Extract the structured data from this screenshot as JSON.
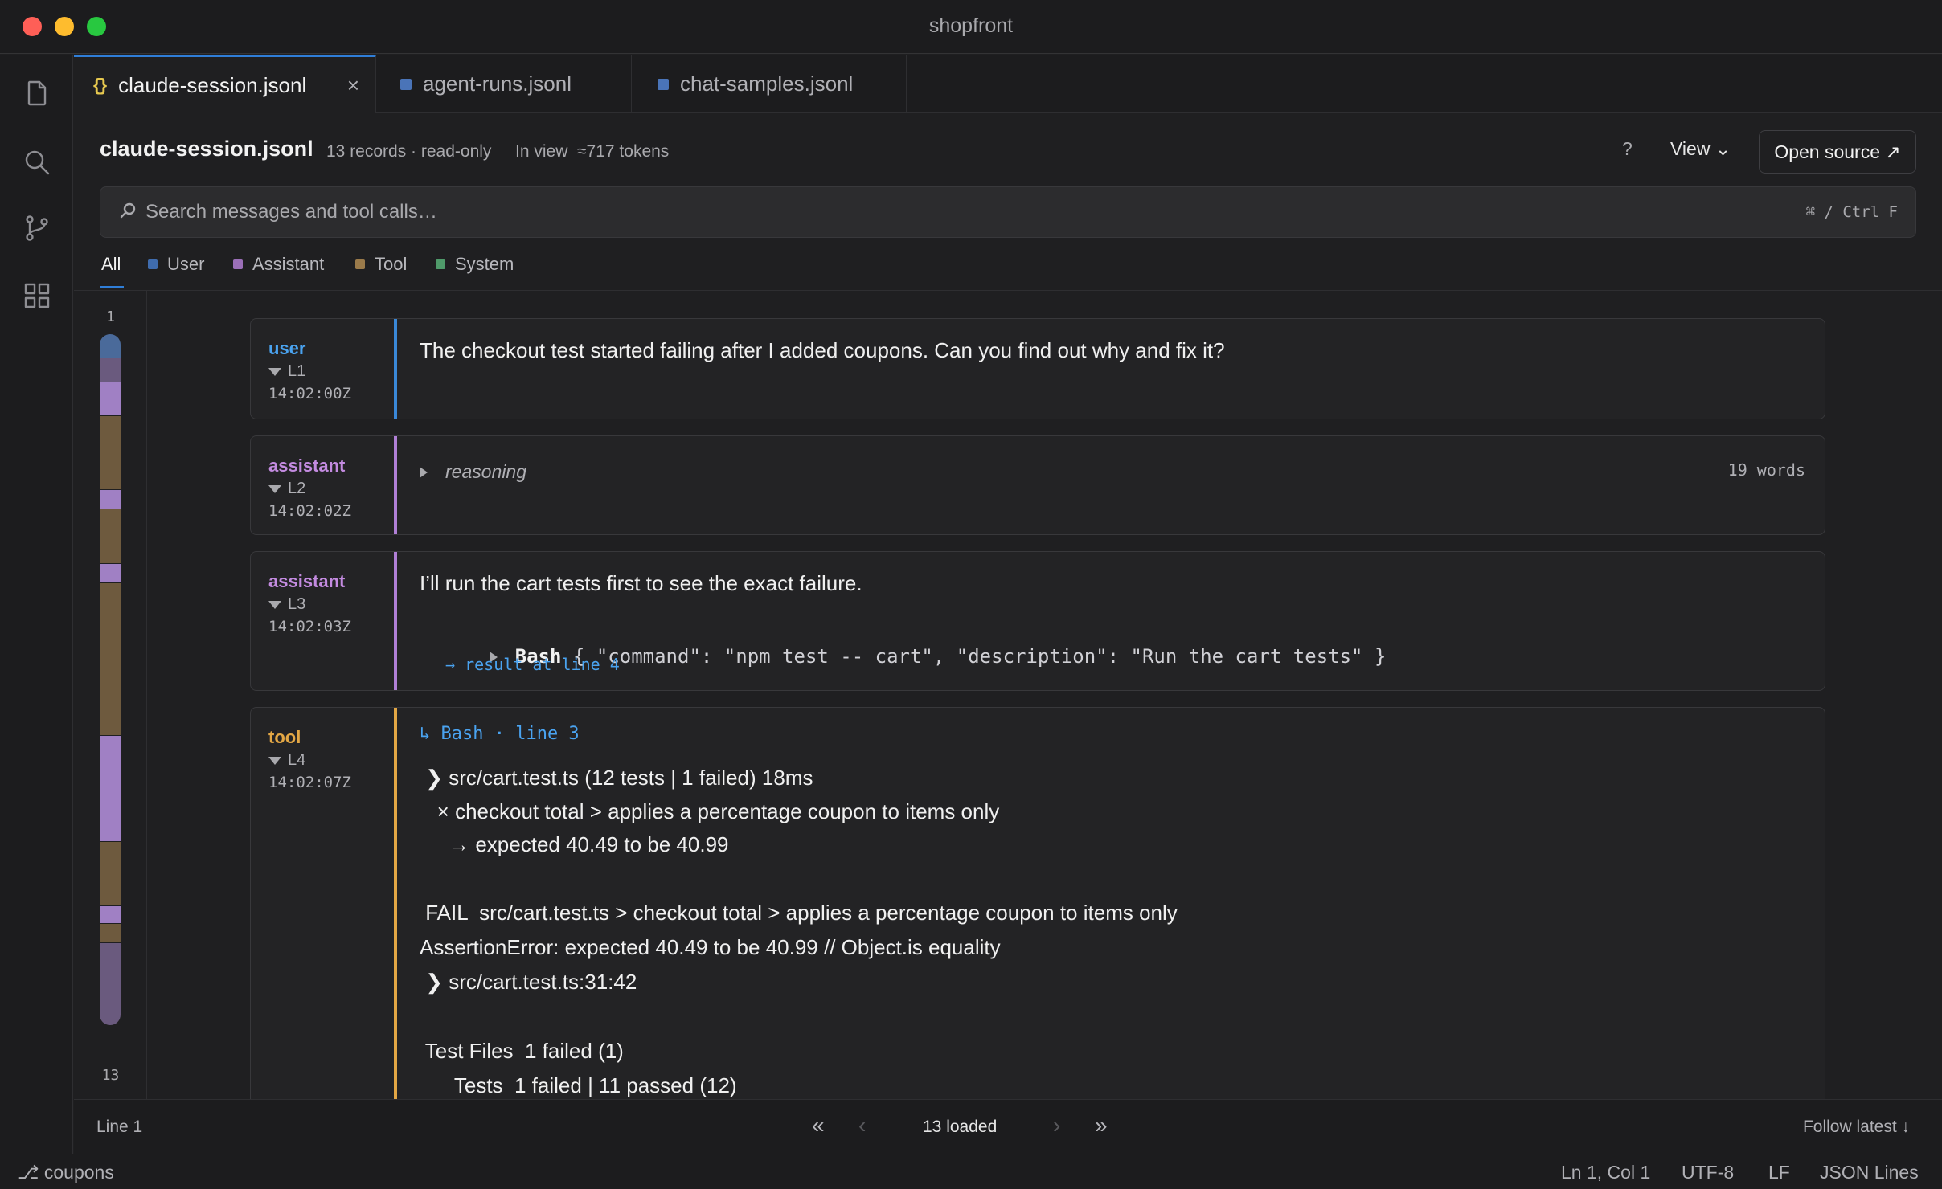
{
  "window": {
    "title": "shopfront"
  },
  "tabs": [
    {
      "label": "claude-session.jsonl",
      "icon": "json-braces-icon",
      "active": true
    },
    {
      "label": "agent-runs.jsonl",
      "icon": "file-square-icon",
      "active": false
    },
    {
      "label": "chat-samples.jsonl",
      "icon": "file-square-icon",
      "active": false
    }
  ],
  "header": {
    "filename": "claude-session.jsonl",
    "records": "13 records · read-only",
    "in_view": "In view  ≈717 tokens",
    "help": "?",
    "view_label": "View ⌄",
    "open_source": "Open source ↗"
  },
  "search": {
    "placeholder": "Search messages and tool calls…",
    "shortcut": "⌘ / Ctrl F"
  },
  "filters": [
    {
      "label": "All",
      "active": true
    },
    {
      "label": "User",
      "color": "#3f6cae"
    },
    {
      "label": "Assistant",
      "color": "#9b6fb8"
    },
    {
      "label": "Tool",
      "color": "#9a7a4a"
    },
    {
      "label": "System",
      "color": "#4f9a6a"
    }
  ],
  "minimap": {
    "start": "1",
    "end": "13"
  },
  "messages": [
    {
      "role": "user",
      "line": "L1",
      "time": "14:02:00Z",
      "text": "The checkout test started failing after I added coupons. Can you find out why and fix it?"
    },
    {
      "role": "assistant",
      "line": "L2",
      "time": "14:02:02Z",
      "reasoning_label": "reasoning",
      "word_count": "19 words"
    },
    {
      "role": "assistant",
      "line": "L3",
      "time": "14:02:03Z",
      "text": "I’ll run the cart tests first to see the exact failure.",
      "tool_name": "Bash",
      "tool_args": "{ \"command\": \"npm test -- cart\", \"description\": \"Run the cart tests\" }",
      "result_link": "→ result at line 4"
    },
    {
      "role": "tool",
      "line": "L4",
      "time": "14:02:07Z",
      "ref": "↳ Bash · line 3",
      "output": [
        " ❯ src/cart.test.ts (12 tests | 1 failed) 18ms",
        "   × checkout total > applies a percentage coupon to items only",
        "     → expected 40.49 to be 40.99",
        "",
        " FAIL  src/cart.test.ts > checkout total > applies a percentage coupon to items only",
        "AssertionError: expected 40.49 to be 40.99 // Object.is equality",
        " ❯ src/cart.test.ts:31:42",
        "",
        " Test Files  1 failed (1)",
        "      Tests  1 failed | 11 passed (12)"
      ]
    }
  ],
  "pager": {
    "line": "Line 1",
    "first": "«",
    "prev": "‹",
    "loaded": "13 loaded",
    "next": "›",
    "last": "»",
    "follow": "Follow latest ↓"
  },
  "status": {
    "branch": "⎇ coupons",
    "position": "Ln 1, Col 1",
    "encoding": "UTF-8",
    "eol": "LF",
    "language": "JSON Lines"
  },
  "colors": {
    "user": "#4aa3f0",
    "assistant": "#c38be0",
    "tool": "#e3a745",
    "accent": "#2f7ed8"
  }
}
